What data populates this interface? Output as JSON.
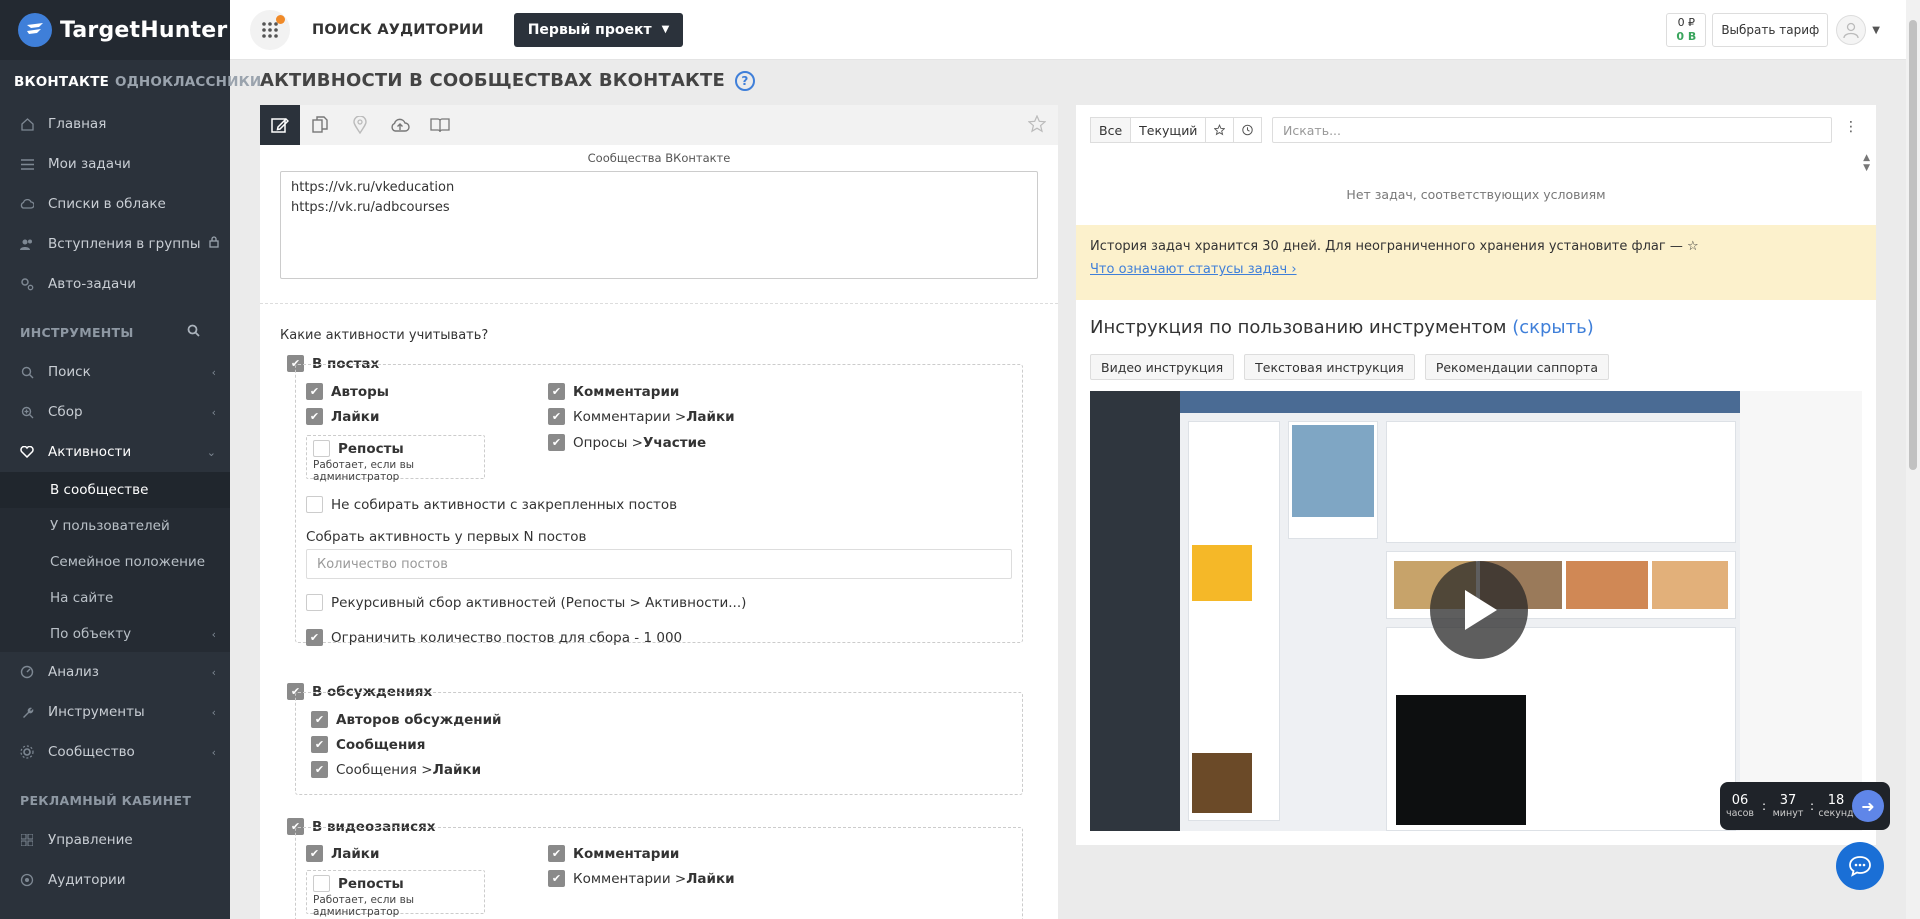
{
  "sidebar": {
    "logo_text": "TargetHunter",
    "networks": {
      "active": "ВКОНТАКТЕ",
      "inactive": "ОДНОКЛАССНИКИ"
    },
    "main_items": [
      {
        "label": "Главная",
        "icon": "home-icon"
      },
      {
        "label": "Мои задачи",
        "icon": "list-icon"
      },
      {
        "label": "Списки в облаке",
        "icon": "cloud-icon"
      },
      {
        "label": "Вступления в группы",
        "icon": "users-icon",
        "locked": true
      },
      {
        "label": "Авто-задачи",
        "icon": "cogs-icon"
      }
    ],
    "tools_section": "ИНСТРУМЕНТЫ",
    "tools_items": [
      {
        "label": "Поиск",
        "icon": "search-icon"
      },
      {
        "label": "Сбор",
        "icon": "search-plus-icon"
      },
      {
        "label": "Активности",
        "icon": "heart-icon"
      }
    ],
    "activity_sub": [
      {
        "label": "В сообществе",
        "active": true
      },
      {
        "label": "У пользователей"
      },
      {
        "label": "Семейное положение"
      },
      {
        "label": "На сайте"
      },
      {
        "label": "По объекту"
      }
    ],
    "more_items": [
      {
        "label": "Анализ",
        "icon": "gauge-icon"
      },
      {
        "label": "Инструменты",
        "icon": "wrench-icon"
      },
      {
        "label": "Сообщество",
        "icon": "gear-icon"
      }
    ],
    "ads_section": "РЕКЛАМНЫЙ КАБИНЕТ",
    "ads_items": [
      {
        "label": "Управление",
        "icon": "grid-icon"
      },
      {
        "label": "Аудитории",
        "icon": "target-icon"
      }
    ]
  },
  "header": {
    "title": "ПОИСК АУДИТОРИИ",
    "project": "Первый проект",
    "balance_rub": "0 ₽",
    "balance_b": "0 B",
    "tariff": "Выбрать тариф"
  },
  "page": {
    "title": "АКТИВНОСТИ В СООБЩЕСТВАХ ВКОНТАКТЕ",
    "help": "?"
  },
  "form": {
    "communities_label": "Сообщества ВКонтакте",
    "communities_lines": [
      "https://vk.ru/vkeducation",
      "https://vk.ru/adbcourses"
    ],
    "question": "Какие активности учитывать?",
    "posts": {
      "title": "В постах",
      "authors": "Авторы",
      "likes": "Лайки",
      "reposts": "Репосты",
      "reposts_hint": "Работает, если вы администратор",
      "comments": "Комментарии",
      "comments_likes_prefix": "Комментарии > ",
      "comments_likes_bold": "Лайки",
      "polls_prefix": "Опросы > ",
      "polls_bold": "Участие",
      "no_pinned": "Не собирать активности с закрепленных постов",
      "first_n_label": "Собрать активность у первых N постов",
      "first_n_placeholder": "Количество постов",
      "recursive": "Рекурсивный сбор активностей (Репосты > Активности...)",
      "limit": "Ограничить количество постов для сбора - 1 000"
    },
    "discussions": {
      "title": "В обсуждениях",
      "authors": "Авторов обсуждений",
      "messages": "Сообщения",
      "messages_likes_prefix": "Сообщения > ",
      "messages_likes_bold": "Лайки"
    },
    "videos": {
      "title": "В видеозаписях",
      "likes": "Лайки",
      "reposts": "Репосты",
      "reposts_hint": "Работает, если вы администратор",
      "comments": "Комментарии",
      "comments_likes_prefix": "Комментарии > ",
      "comments_likes_bold": "Лайки"
    }
  },
  "tasks": {
    "filter_all": "Все",
    "filter_current": "Текущий",
    "search_placeholder": "Искать...",
    "empty": "Нет задач, соответствующих условиям",
    "notice": "История задач хранится 30 дней. Для неограниченного хранения установите флаг — ☆",
    "notice_link": "Что означают статусы задач ›"
  },
  "instructions": {
    "title": "Инструкция по пользованию инструментом",
    "hide": "(скрыть)",
    "tabs": [
      "Видео инструкция",
      "Текстовая инструкция",
      "Рекомендации саппорта"
    ]
  },
  "timer": {
    "hours": "06",
    "minutes": "37",
    "seconds": "18",
    "hours_label": "часов",
    "minutes_label": "минут",
    "seconds_label": "секунд"
  },
  "colors": {
    "sidebar": "#2b323b",
    "accent": "#3f7fd9",
    "notice": "#fcf1cc"
  }
}
